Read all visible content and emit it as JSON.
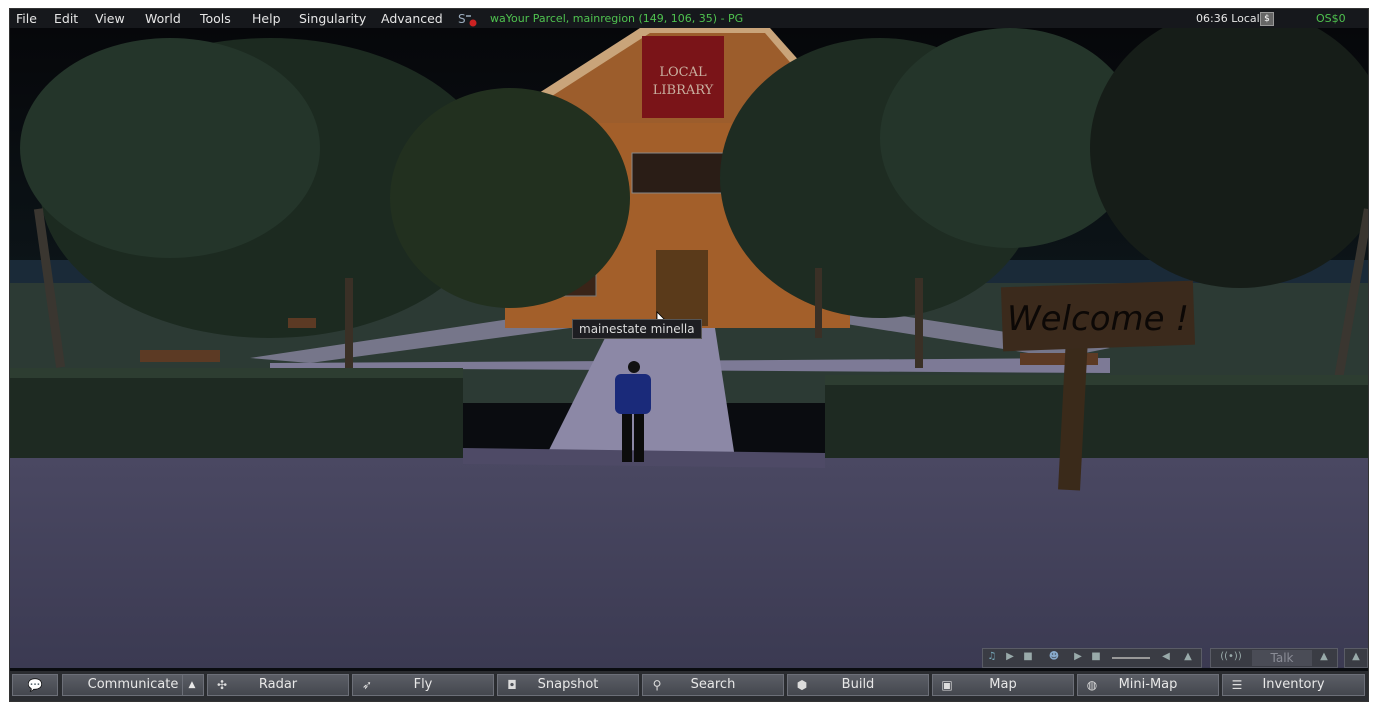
{
  "menubar": {
    "items": [
      "File",
      "Edit",
      "View",
      "World",
      "Tools",
      "Help",
      "Singularity",
      "Advanced"
    ],
    "location": "waYour Parcel, mainregion (149, 106, 35) - PG",
    "clock": "06:36 Local",
    "buy_currency_label": "$",
    "balance": "OS$0"
  },
  "scene": {
    "sign_text": "Welcome !",
    "library_sign_line1": "LOCAL",
    "library_sign_line2": "LIBRARY",
    "hover_tooltip": "mainestate minella"
  },
  "media_controls": {
    "talk_label": "Talk"
  },
  "bottombar": {
    "buttons": [
      "Communicate",
      "Radar",
      "Fly",
      "Snapshot",
      "Search",
      "Build",
      "Map",
      "Mini-Map",
      "Inventory"
    ]
  },
  "icons": [
    "chat-bubble-icon",
    "radar-icon",
    "fly-icon",
    "camera-icon",
    "magnifier-icon",
    "cube-icon",
    "map-icon",
    "minimap-globe-icon",
    "inventory-icon",
    "music-note-icon",
    "play-icon",
    "stop-icon",
    "people-icon",
    "volume-icon",
    "up-arrow-icon"
  ]
}
